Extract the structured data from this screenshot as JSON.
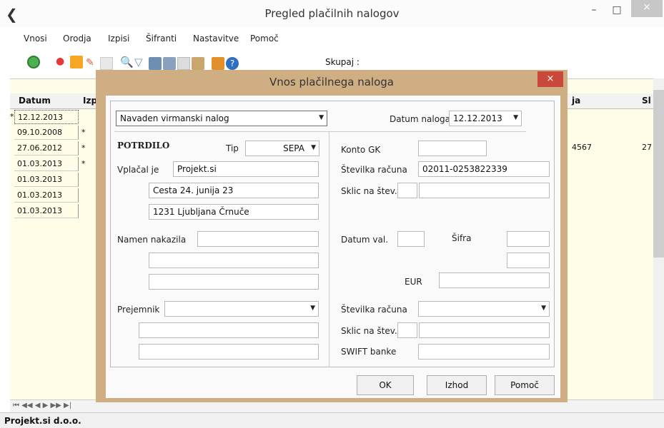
{
  "window": {
    "title": "Pregled plačilnih nalogov",
    "min": "–",
    "max": "□",
    "close": "×"
  },
  "menu": [
    "Vnosi",
    "Orodja",
    "Izpisi",
    "Šifranti",
    "Nastavitve",
    "Pomoč"
  ],
  "toolbar": {
    "skupaj_label": "Skupaj :",
    "skupaj_value": ""
  },
  "grid": {
    "columns": [
      "Datum",
      "Izp",
      "ja",
      "Sl"
    ],
    "rows": [
      {
        "marker": "*",
        "date": "12.12.2013",
        "flag": ""
      },
      {
        "marker": "",
        "date": "09.10.2008",
        "flag": "*"
      },
      {
        "marker": "",
        "date": "27.06.2012",
        "flag": "*"
      },
      {
        "marker": "",
        "date": "01.03.2013",
        "flag": "*"
      },
      {
        "marker": "",
        "date": "01.03.2013",
        "flag": ""
      },
      {
        "marker": "",
        "date": "01.03.2013",
        "flag": ""
      },
      {
        "marker": "",
        "date": "01.03.2013",
        "flag": ""
      }
    ],
    "right_values": {
      "ja": "4567",
      "sl": "27"
    },
    "nav": "⏮ ◀◀ ◀ ▶ ▶▶ ▶|"
  },
  "status": {
    "company": "Projekt.si d.o.o."
  },
  "dialog": {
    "title": "Vnos plačilnega naloga",
    "close": "×",
    "nalog_type": "Navaden virmanski nalog",
    "datum_naloga_label": "Datum naloga",
    "datum_naloga": "12.12.2013",
    "potrdilo_label": "POTRDILO",
    "tip_label": "Tip",
    "tip_value": "SEPA",
    "vplacal_label": "Vplačal je",
    "vplacal_name": "Projekt.si",
    "vplacal_street": "Cesta 24. junija 23",
    "vplacal_city": "1231 Ljubljana Črnuče",
    "namen_label": "Namen nakazila",
    "prejemnik_label": "Prejemnik",
    "konto_gk_label": "Konto GK",
    "konto_gk": "",
    "stevilka_racuna_label": "Številka računa",
    "stevilka_racuna": "02011-0253822339",
    "sklic_label": "Sklic na štev.",
    "datum_val_label": "Datum val.",
    "sifra_label": "Šifra",
    "eur_label": "EUR",
    "prej_stevilka_racuna_label": "Številka računa",
    "prej_sklic_label": "Sklic na štev.",
    "swift_label": "SWIFT banke",
    "ok": "OK",
    "izhod": "Izhod",
    "pomoc": "Pomoč"
  }
}
